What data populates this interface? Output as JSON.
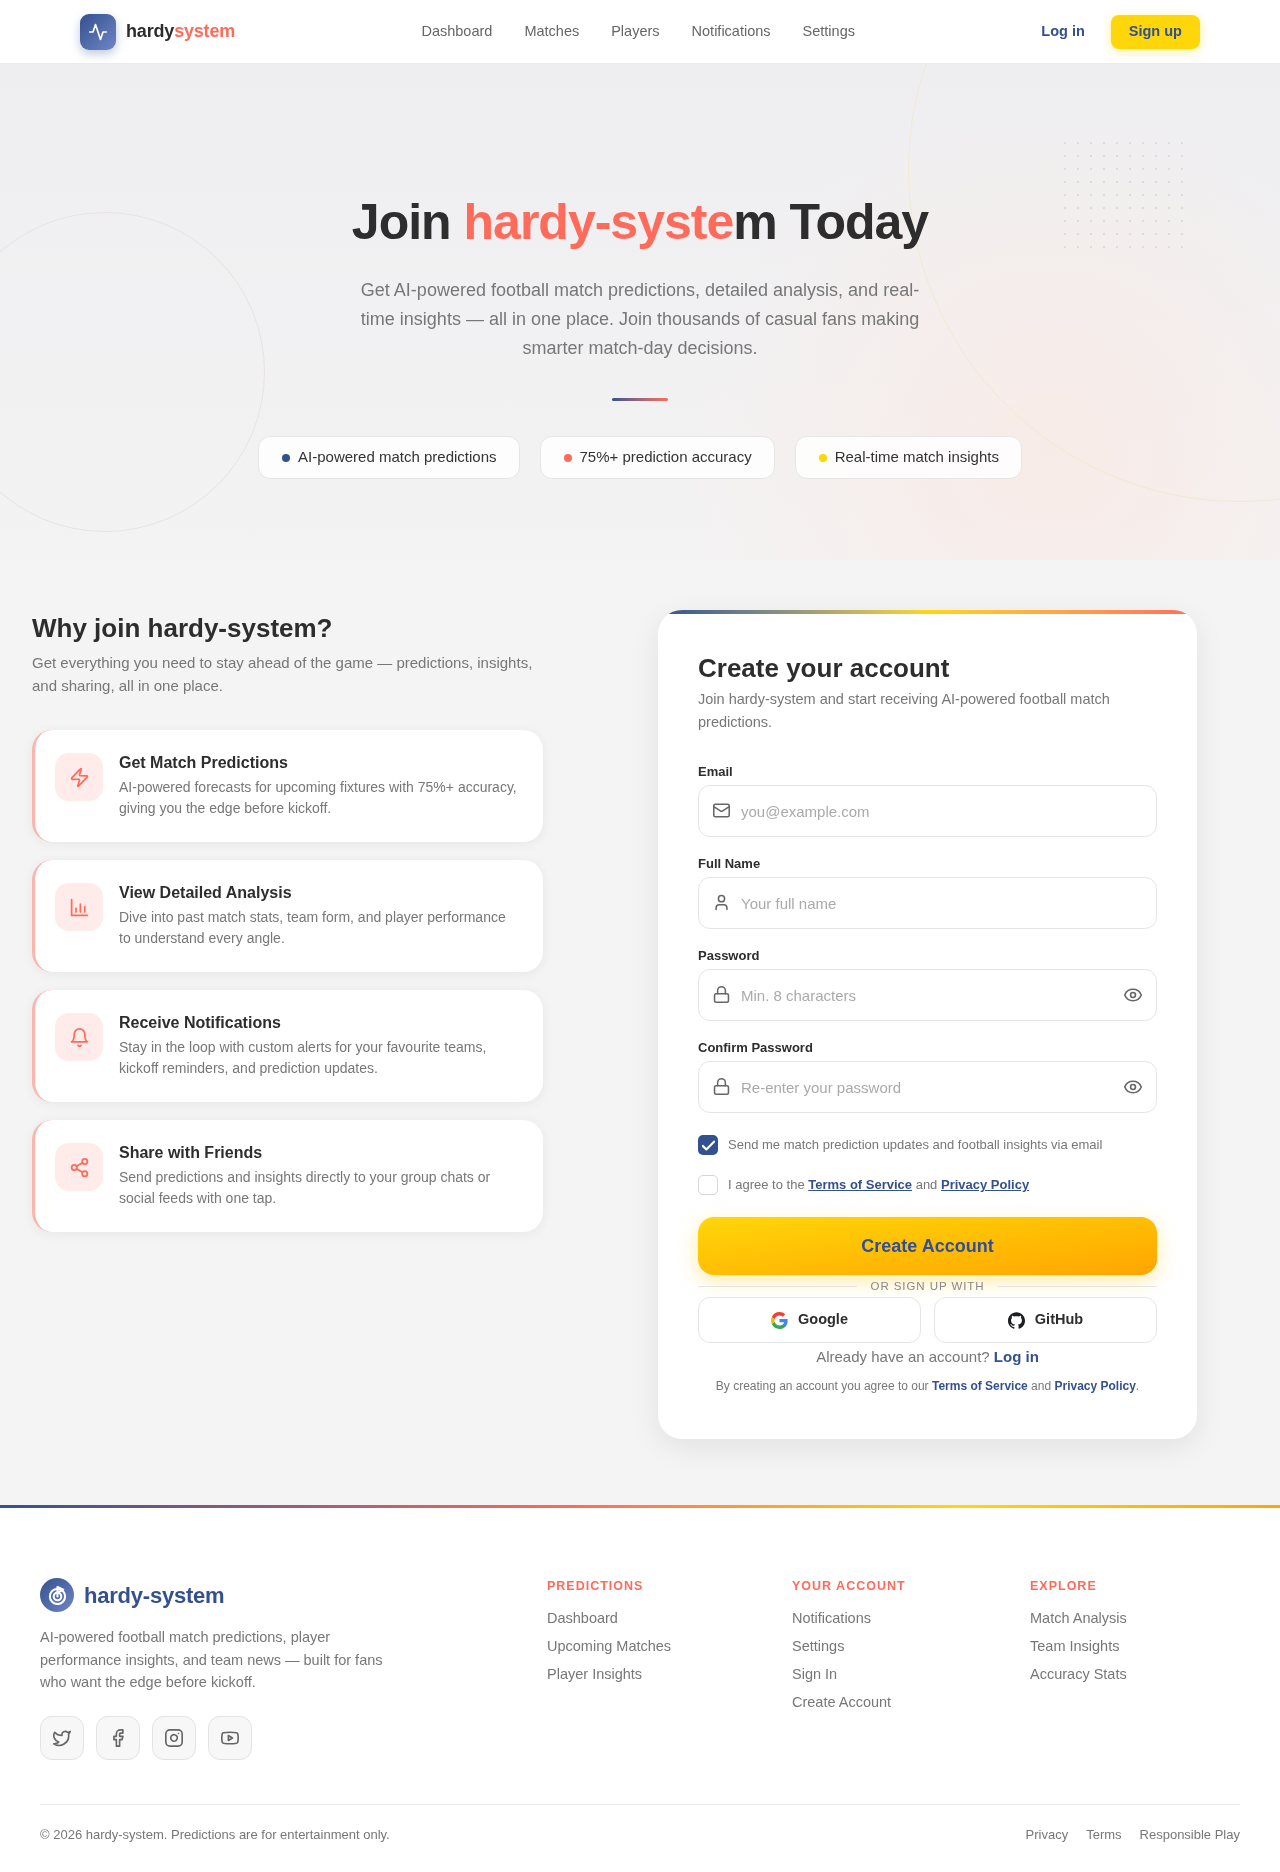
{
  "header": {
    "logo": [
      {
        "text": "hardy",
        "accent": false
      },
      {
        "text": "system",
        "accent": true
      }
    ],
    "nav_links": [
      "Dashboard",
      "Matches",
      "Players",
      "Notifications",
      "Settings"
    ],
    "login": "Log in",
    "signup": "Sign up"
  },
  "hero": {
    "title": [
      {
        "text": "Join ",
        "accent": false
      },
      {
        "text": "hardy-syste",
        "accent": true
      },
      {
        "text": "m Today",
        "accent": false
      }
    ],
    "subtitle": "Get AI-powered football match predictions, detailed analysis, and real-time insights — all in one place. Join thousands of casual fans making smarter match-day decisions.",
    "pills": [
      {
        "label": "AI-powered match predictions",
        "color": "#34518f"
      },
      {
        "label": "75%+ prediction accuracy",
        "color": "#ff6b5b"
      },
      {
        "label": "Real-time match insights",
        "color": "#ffd60a"
      }
    ]
  },
  "benefits": {
    "title": "Why join hardy-system?",
    "subtitle": "Get everything you need to stay ahead of the game — predictions, insights, and sharing, all in one place.",
    "items": [
      {
        "title": "Get Match Predictions",
        "description": "AI-powered forecasts for upcoming fixtures with 75%+ accuracy, giving you the edge before kickoff."
      },
      {
        "title": "View Detailed Analysis",
        "description": "Dive into past match stats, team form, and player performance to understand every angle."
      },
      {
        "title": "Receive Notifications",
        "description": "Stay in the loop with custom alerts for your favourite teams, kickoff reminders, and prediction updates."
      },
      {
        "title": "Share with Friends",
        "description": "Send predictions and insights directly to your group chats or social feeds with one tap."
      }
    ]
  },
  "signup": {
    "title": "Create your account",
    "subtitle": "Join hardy-system and start receiving AI-powered football match predictions.",
    "fields": [
      {
        "kind": "email",
        "label": "Email",
        "placeholder": "you@example.com"
      },
      {
        "kind": "text",
        "label": "Full Name",
        "placeholder": "Your full name"
      },
      {
        "kind": "password",
        "label": "Password",
        "placeholder": "Min. 8 characters"
      },
      {
        "kind": "password",
        "label": "Confirm Password",
        "placeholder": "Re-enter your password"
      }
    ],
    "checkboxes": [
      {
        "checked": true,
        "parts": [
          {
            "kind": "text",
            "text": "Send me match prediction updates and football insights via email"
          }
        ]
      },
      {
        "checked": false,
        "parts": [
          {
            "kind": "text",
            "text": "I agree to the "
          },
          {
            "kind": "link",
            "text": "Terms of Service"
          },
          {
            "kind": "text",
            "text": " and "
          },
          {
            "kind": "link",
            "text": "Privacy Policy"
          }
        ]
      }
    ],
    "submit": "Create Account",
    "divider": "OR SIGN UP WITH",
    "providers": [
      {
        "label": "Google"
      },
      {
        "label": "GitHub"
      }
    ],
    "login_prompt": [
      {
        "kind": "text",
        "text": "Already have an account? "
      },
      {
        "kind": "link",
        "text": "Log in"
      }
    ],
    "legal": [
      {
        "kind": "text",
        "text": "By creating an account you agree to our "
      },
      {
        "kind": "link",
        "text": "Terms of Service"
      },
      {
        "kind": "text",
        "text": " and "
      },
      {
        "kind": "link",
        "text": "Privacy Policy"
      },
      {
        "kind": "text",
        "text": "."
      }
    ]
  },
  "footer": {
    "brand": "hardy-system",
    "description": "AI-powered football match predictions, player performance insights, and team news — built for fans who want the edge before kickoff.",
    "columns": [
      {
        "heading": "PREDICTIONS",
        "links": [
          "Dashboard",
          "Upcoming Matches",
          "Player Insights"
        ]
      },
      {
        "heading": "YOUR ACCOUNT",
        "links": [
          "Notifications",
          "Settings",
          "Sign In",
          "Create Account"
        ]
      },
      {
        "heading": "EXPLORE",
        "links": [
          "Match Analysis",
          "Team Insights",
          "Accuracy Stats"
        ]
      }
    ],
    "copyright": "© 2026 hardy-system. Predictions are for entertainment only.",
    "legal_links": [
      "Privacy",
      "Terms",
      "Responsible Play"
    ]
  }
}
